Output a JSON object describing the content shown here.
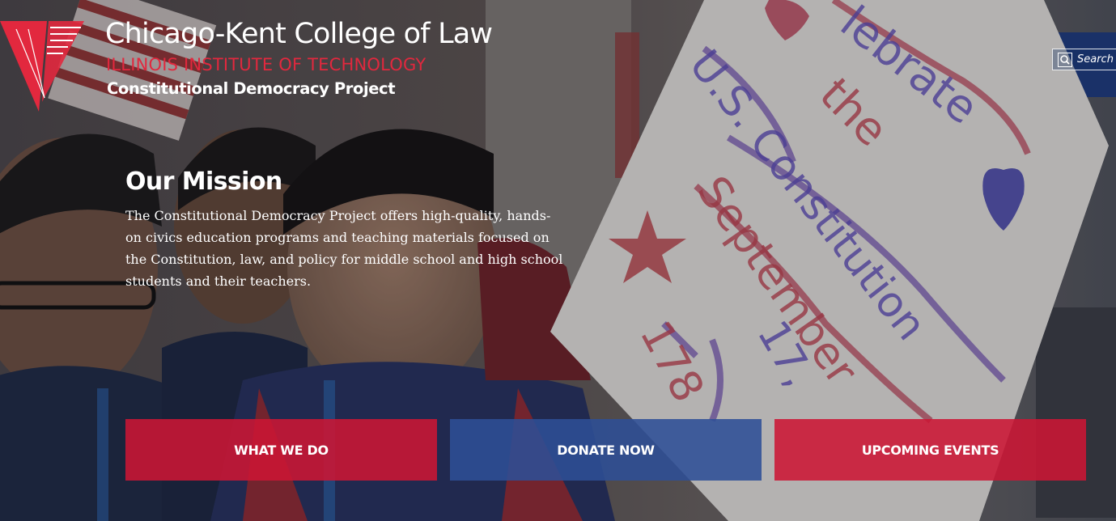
{
  "header": {
    "logo_title": "Chicago-Kent College of Law",
    "logo_subtitle": "ILLINOIS INSTITUTE OF TECHNOLOGY",
    "project_name": "Constitutional Democracy Project"
  },
  "search": {
    "placeholder": "Search",
    "icon": "search-icon"
  },
  "mission": {
    "title": "Our Mission",
    "text": "The Constitutional Democracy Project offers high-quality, hands-on civics education programs and teaching materials focused on the Constitution, law, and policy for middle school and high school students and their teachers."
  },
  "buttons": {
    "what_we_do": "WHAT WE DO",
    "donate_now": "DONATE NOW",
    "upcoming_events": "UPCOMING EVENTS"
  },
  "photo": {
    "sign_text": [
      "lebrate",
      "the",
      "U.S. Constitution",
      "September",
      "17,",
      "178"
    ]
  },
  "colors": {
    "brand_red": "#cc1634",
    "brand_blue": "#2e4e96",
    "logo_red": "#e2283e",
    "text": "#ffffff"
  }
}
